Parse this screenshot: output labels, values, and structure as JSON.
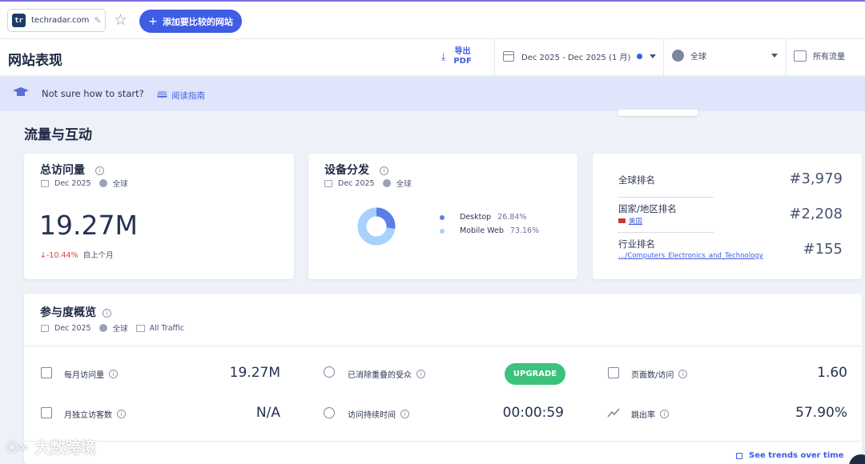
{
  "topbar": {
    "site": "techradar.com",
    "site_logo": "tr",
    "add_compare_label": "添加要比较的网站",
    "icons": [
      "edit-icon",
      "star-icon",
      "plus-icon"
    ]
  },
  "header": {
    "title": "网站表现",
    "export_label_1": "导出",
    "export_label_2": "PDF",
    "date_range": "Dec 2025 - Dec 2025 (1 月)",
    "geo": "全球",
    "traffic": "所有流量"
  },
  "banner": {
    "text": "Not sure how to start?",
    "guide_link": "阅读指南"
  },
  "section": {
    "title": "流量与互动"
  },
  "visits_card": {
    "title": "总访问量",
    "period": "Dec 2025",
    "geo": "全球",
    "value": "19.27M",
    "change": "↓-10.44%",
    "change_sub": "自上个月"
  },
  "device_card": {
    "title": "设备分发",
    "period": "Dec 2025",
    "geo": "全球",
    "desktop_label": "Desktop",
    "desktop_pct": "26.84%",
    "mobile_label": "Mobile Web",
    "mobile_pct": "73.16%",
    "desktop_share": 26.84,
    "mobile_share": 73.16,
    "colors": {
      "desktop": "#5b7ee5",
      "mobile": "#a8d1fb"
    }
  },
  "rank_card": {
    "global_label": "全球排名",
    "global_value": "#3,979",
    "country_label": "国家/地区排名",
    "country_sub": "美国",
    "country_value": "#2,208",
    "industry_label": "行业排名",
    "industry_sub": "…/Computers_Electronics_and_Technology",
    "industry_value": "#155"
  },
  "engagement": {
    "title": "参与度概览",
    "period": "Dec 2025",
    "geo": "全球",
    "traffic": "All Traffic",
    "monthly_visits_label": "每月访问量",
    "monthly_visits_value": "19.27M",
    "unique_label": "月独立访客数",
    "unique_value": "N/A",
    "dedup_label": "已消除重叠的受众",
    "upgrade_label": "UPGRADE",
    "duration_label": "访问持续时间",
    "duration_value": "00:00:59",
    "pages_label": "页面数/访问",
    "pages_value": "1.60",
    "bounce_label": "跳出率",
    "bounce_value": "57.90%",
    "trends_label": "See trends over time"
  },
  "watermark": {
    "text": "大数跨境",
    "logo": "ⓚ∞"
  }
}
